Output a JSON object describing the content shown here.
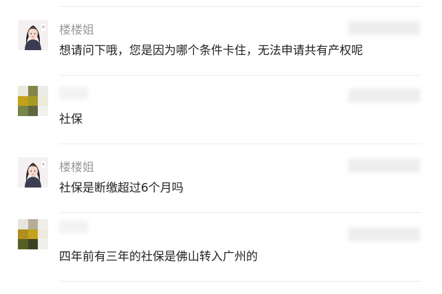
{
  "messages": [
    {
      "sender": "楼楼姐",
      "avatar": "girl-avatar",
      "text": "想请问下哦，您是因为哪个条件卡住，无法申请共有产权呢"
    },
    {
      "sender": "",
      "avatar": "mosaic-avatar",
      "text": "社保"
    },
    {
      "sender": "楼楼姐",
      "avatar": "girl-avatar",
      "text": "社保是断缴超过6个月吗"
    },
    {
      "sender": "",
      "avatar": "mosaic-avatar",
      "text": "四年前有三年的社保是佛山转入广州的"
    }
  ],
  "colors": {
    "sender_name": "#9a9a9a",
    "message_text": "#222222",
    "divider": "#ececec"
  },
  "mosaic_palettes": [
    [
      "#e9e9e0",
      "#86844a",
      "#ecece6",
      "#c2a21a",
      "#a79a26",
      "#ede9dc",
      "#76854a",
      "#61663f",
      "#f1f1ee"
    ],
    [
      "#e6e6df",
      "#b7ad98",
      "#efefe8",
      "#b08f1f",
      "#c2a41c",
      "#eeeadf",
      "#555f24",
      "#3f3f24",
      "#efefec"
    ]
  ]
}
